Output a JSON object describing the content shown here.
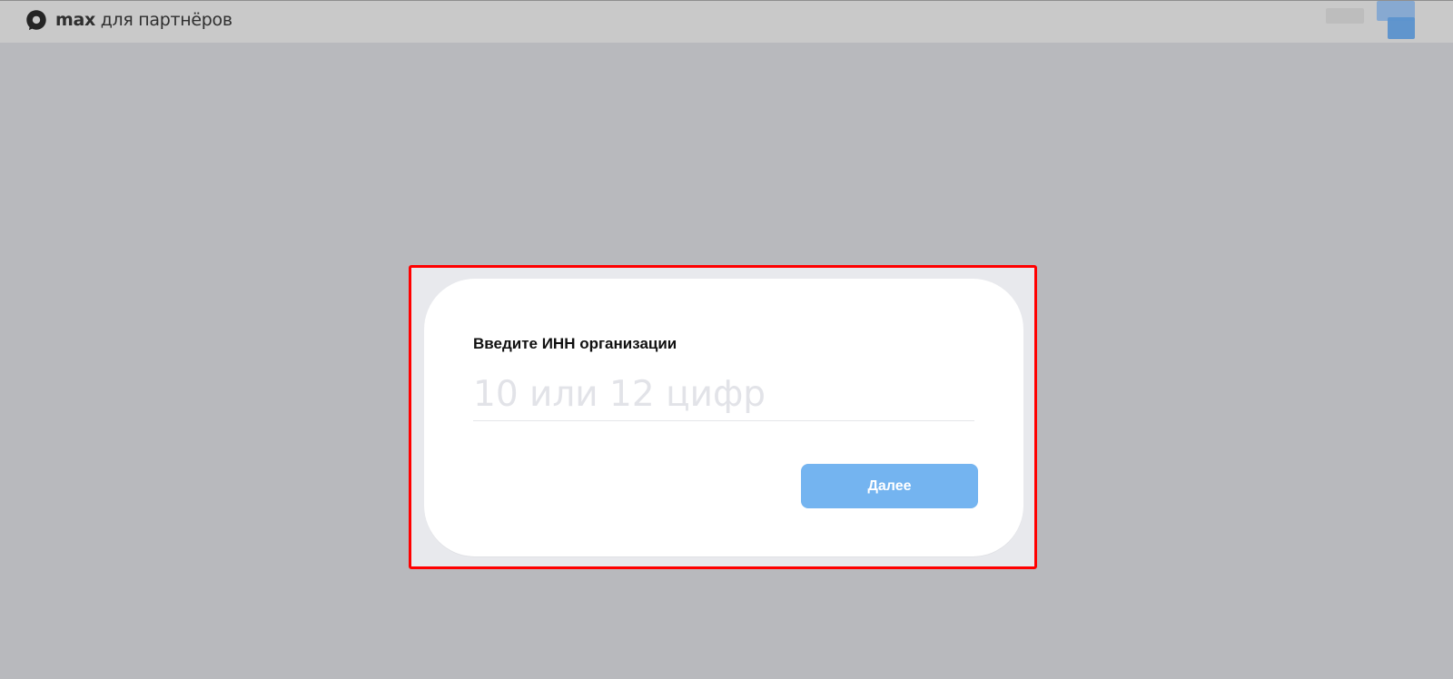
{
  "header": {
    "logo_brand": "max",
    "logo_subtitle": " для партнёров",
    "icons": {
      "logo": "max-logo-icon",
      "avatar": "user-avatar-icon"
    }
  },
  "dialog": {
    "title": "Введите ИНН организации",
    "input_value": "",
    "input_placeholder": "10 или 12 цифр",
    "next_button_label": "Далее"
  },
  "colors": {
    "background": "#b8b9bd",
    "header_background": "#c9c9c9",
    "button": "#74b4f0",
    "highlight": "#ff0000"
  }
}
